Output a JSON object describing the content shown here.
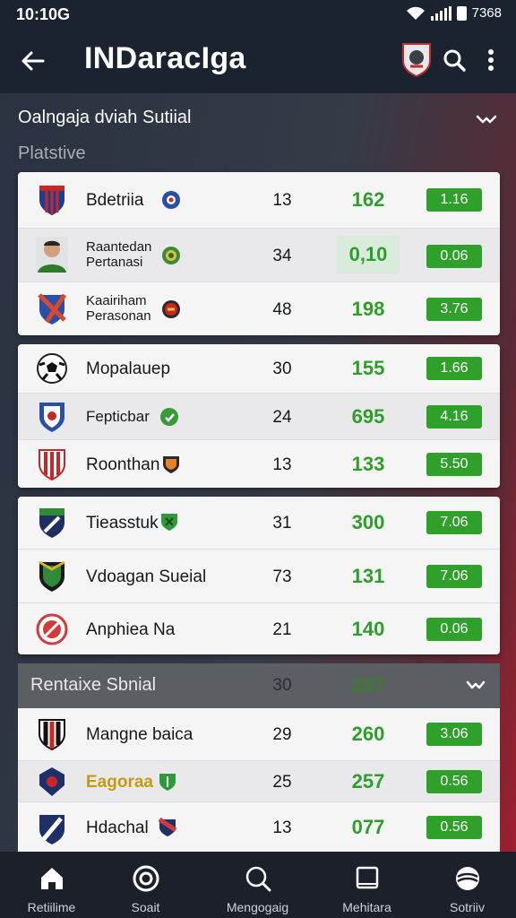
{
  "status_bar": {
    "time": "10:10G",
    "battery_text": "7368"
  },
  "app_bar": {
    "title": "INDaracIga"
  },
  "section": {
    "title": "Oalngaja dviah Sutiial",
    "subtitle": "Platstive"
  },
  "groups": [
    {
      "rows": [
        {
          "name": "Bdetriia",
          "played": "13",
          "points": "162",
          "value": "1.16",
          "logo": "blue-red-striped-shield-icon",
          "badge": "blue-round-crest-icon"
        },
        {
          "name_lines": [
            "Raantedan",
            "Pertanasi"
          ],
          "played": "34",
          "points": "0,10",
          "value": "0.06",
          "logo": "player-portrait-icon",
          "badge": "green-round-crest-icon"
        },
        {
          "name_lines": [
            "Kaairiham",
            "Perasonan"
          ],
          "played": "48",
          "points": "198",
          "value": "3.76",
          "logo": "red-blue-shield-icon",
          "badge": "red-yellow-round-crest-icon"
        }
      ]
    },
    {
      "rows": [
        {
          "name": "Mopalauep",
          "played": "30",
          "points": "155",
          "value": "1.66",
          "logo": "soccer-ball-icon"
        },
        {
          "name": "Fepticbar",
          "played": "24",
          "points": "695",
          "value": "4.16",
          "logo": "blue-white-shield-icon",
          "badge": "green-round-crest-icon"
        },
        {
          "name": "Roonthan",
          "played": "13",
          "points": "133",
          "value": "5.50",
          "logo": "red-striped-shield-icon",
          "badge": "orange-shield-icon"
        }
      ]
    },
    {
      "rows": [
        {
          "name": "Tieasstuk",
          "played": "31",
          "points": "300",
          "value": "7.06",
          "logo": "green-navy-shield-icon",
          "badge": "green-shield-icon"
        },
        {
          "name": "Vdoagan Sueial",
          "played": "73",
          "points": "131",
          "value": "7.06",
          "logo": "green-gold-shield-icon"
        },
        {
          "name": "Anphiea Na",
          "played": "21",
          "points": "140",
          "value": "0.06",
          "logo": "red-circle-crest-icon"
        }
      ]
    }
  ],
  "section2": {
    "title": "Rentaixe Sbnial",
    "played": "30",
    "points": "287",
    "rows": [
      {
        "name": "Mangne baica",
        "played": "29",
        "points": "260",
        "value": "3.06",
        "logo": "black-red-striped-shield-icon"
      },
      {
        "name": "Eagoraa",
        "played": "25",
        "points": "257",
        "value": "0.56",
        "logo": "navy-red-round-crest-icon",
        "badge": "green-shield-icon"
      },
      {
        "name": "Hdachal",
        "played": "13",
        "points": "077",
        "value": "0.56",
        "logo": "navy-white-shield-icon",
        "badge": "red-navy-shield-icon"
      }
    ]
  },
  "nav": [
    {
      "label": "Retiilime",
      "icon": "home-icon"
    },
    {
      "label": "Soait",
      "icon": "target-icon"
    },
    {
      "label": "Mengogaig",
      "icon": "search-icon"
    },
    {
      "label": "Mehitara",
      "icon": "tablet-icon"
    },
    {
      "label": "Sotriiv",
      "icon": "ball-icon"
    }
  ],
  "colors": {
    "accent_green": "#2fa12b",
    "points_green": "#2e9e2a",
    "bar_dark": "#1c2330",
    "accent_red": "#a81e2e"
  }
}
